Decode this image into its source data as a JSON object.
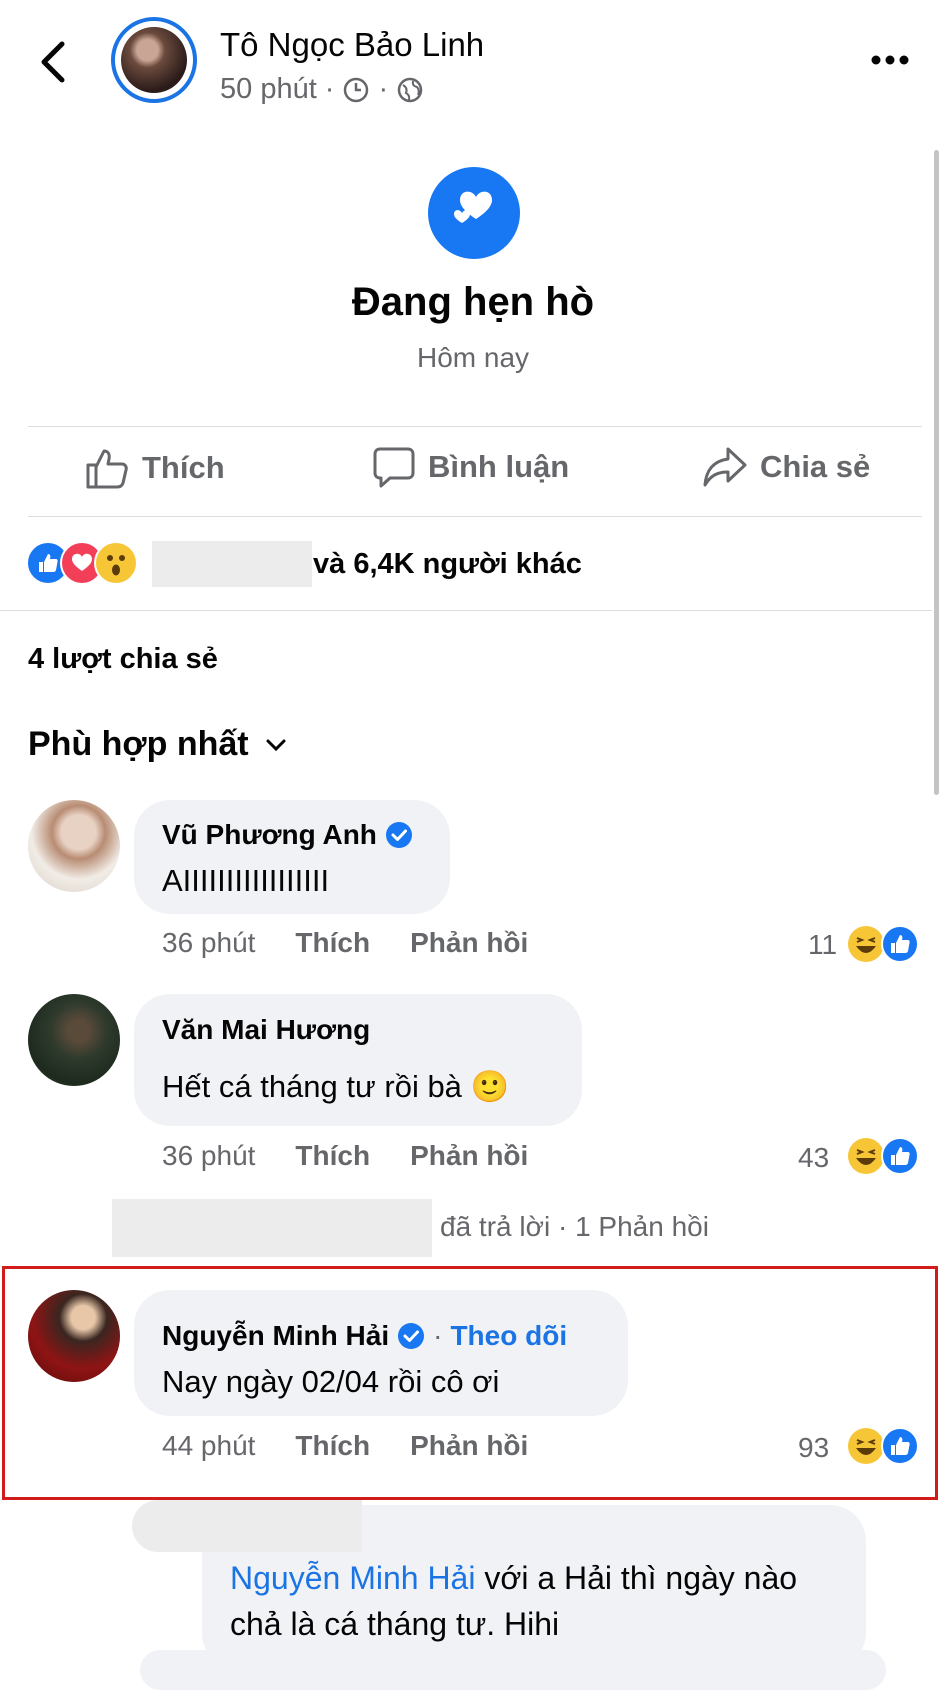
{
  "header": {
    "author": "Tô Ngọc Bảo Linh",
    "time": "50 phút",
    "separator": "·",
    "back_icon": "chevron-left-icon",
    "more_icon": "more-horizontal-icon",
    "clock_icon": "clock-icon",
    "globe_icon": "globe-icon"
  },
  "life_event": {
    "icon": "hearts-icon",
    "title": "Đang hẹn hò",
    "date": "Hôm nay"
  },
  "actions": {
    "like": "Thích",
    "comment": "Bình luận",
    "share": "Chia sẻ"
  },
  "reactions": {
    "types": [
      "like",
      "love",
      "wow"
    ],
    "others": "và 6,4K người khác"
  },
  "shares_text": "4 lượt chia sẻ",
  "sort_label": "Phù hợp nhất",
  "comments": [
    {
      "name": "Vũ Phương Anh",
      "verified": true,
      "text": "AIIIIIIIIIIIIIIIII",
      "time": "36 phút",
      "like": "Thích",
      "reply": "Phản hồi",
      "count": "11"
    },
    {
      "name": "Văn Mai Hương",
      "verified": false,
      "text": "Hết cá tháng tư rồi bà 🙂",
      "time": "36 phút",
      "like": "Thích",
      "reply": "Phản hồi",
      "count": "43"
    },
    {
      "name": "Nguyễn Minh Hải",
      "verified": true,
      "follow": "Theo dõi",
      "text": "Nay ngày 02/04 rồi cô ơi",
      "time": "44 phút",
      "like": "Thích",
      "reply": "Phản hồi",
      "count": "93"
    }
  ],
  "reply_note": "đã trả lời · 1 Phản hồi",
  "sub_reply": {
    "mention": "Nguyễn Minh Hải",
    "text": " với a Hải thì ngày nào chả là cá tháng tư. Hihi"
  },
  "colors": {
    "accent": "#1877f2",
    "highlight_border": "#d21c1c",
    "secondary_text": "#65676b",
    "bubble": "#f0f2f5"
  }
}
